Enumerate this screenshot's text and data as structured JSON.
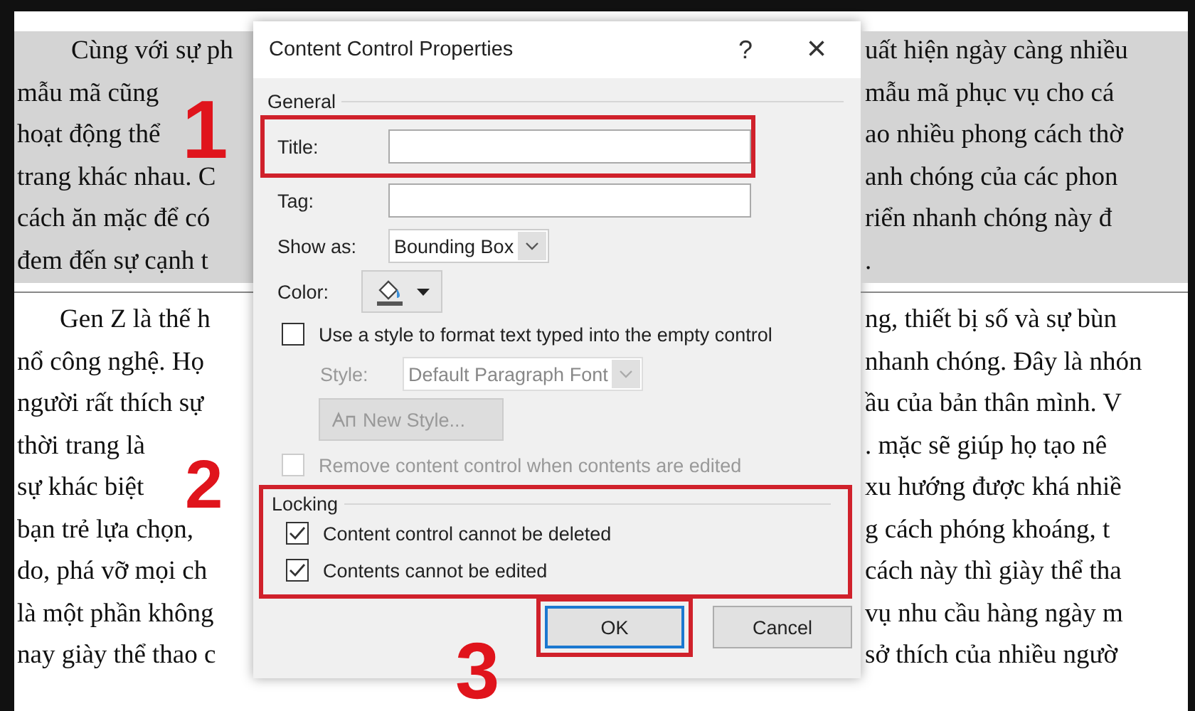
{
  "document": {
    "paragraphs": [
      {
        "highlighted": true,
        "left_lines": [
          "Cùng với sự ph",
          "mẫu mã cũng",
          "hoạt động thể",
          "trang khác nhau. C",
          "cách ăn mặc để có",
          "đem đến sự cạnh t"
        ],
        "right_lines": [
          "uất hiện ngày càng nhiều",
          "mẫu mã phục vụ cho cá",
          "ao nhiều phong cách thờ",
          "anh chóng của các phon",
          "riển  nhanh chóng này đ",
          "."
        ]
      },
      {
        "highlighted": false,
        "left_lines": [
          "Gen Z là thế h",
          "nổ công nghệ. Họ",
          "người rất thích sự",
          "thời trang là",
          "sự khác biệt",
          "bạn trẻ lựa chọn,",
          "do, phá vỡ mọi ch",
          "là một phần không",
          "nay giày thể thao c"
        ],
        "right_lines": [
          "ng, thiết bị số và sự bùn",
          "nhanh chóng. Đây là nhón",
          "ầu của bản thân mình. V",
          ". mặc sẽ giúp  họ tạo nê",
          "xu hướng được khá nhiề",
          "g cách phóng khoáng, t",
          "cách này thì giày thể tha",
          "vụ nhu cầu hàng ngày m",
          "sở thích của nhiều ngườ"
        ]
      }
    ]
  },
  "dialog": {
    "title": "Content Control Properties",
    "help": "?",
    "close": "×",
    "general_label": "General",
    "fields": [
      {
        "kind": "text",
        "label": "Title:",
        "highlighted": true
      },
      {
        "kind": "text",
        "label": "Tag:",
        "highlighted": false
      },
      {
        "kind": "dropdown",
        "label": "Show as:",
        "value": "Bounding Box",
        "highlighted": false
      },
      {
        "kind": "color",
        "label": "Color:",
        "highlighted": false
      }
    ],
    "use_style": {
      "label": "Use a style to format text typed into the empty control",
      "checked": false,
      "disabled": false
    },
    "style": {
      "label": "Style:",
      "value": "Default Paragraph Font",
      "disabled": true
    },
    "new_style": {
      "label": "New Style...",
      "disabled": true
    },
    "remove": {
      "label": "Remove content control when contents are edited",
      "checked": false,
      "disabled": true
    },
    "locking_label": "Locking",
    "locking_highlighted": true,
    "locking": [
      {
        "label": "Content control cannot be deleted",
        "checked": true,
        "disabled": false
      },
      {
        "label": "Contents cannot be edited",
        "checked": true,
        "disabled": false
      }
    ],
    "buttons": [
      {
        "label": "OK",
        "default": true,
        "highlighted": true
      },
      {
        "label": "Cancel",
        "default": false,
        "highlighted": false
      }
    ]
  },
  "annotations": [
    {
      "label": "1"
    },
    {
      "label": "2"
    },
    {
      "label": "3"
    }
  ]
}
